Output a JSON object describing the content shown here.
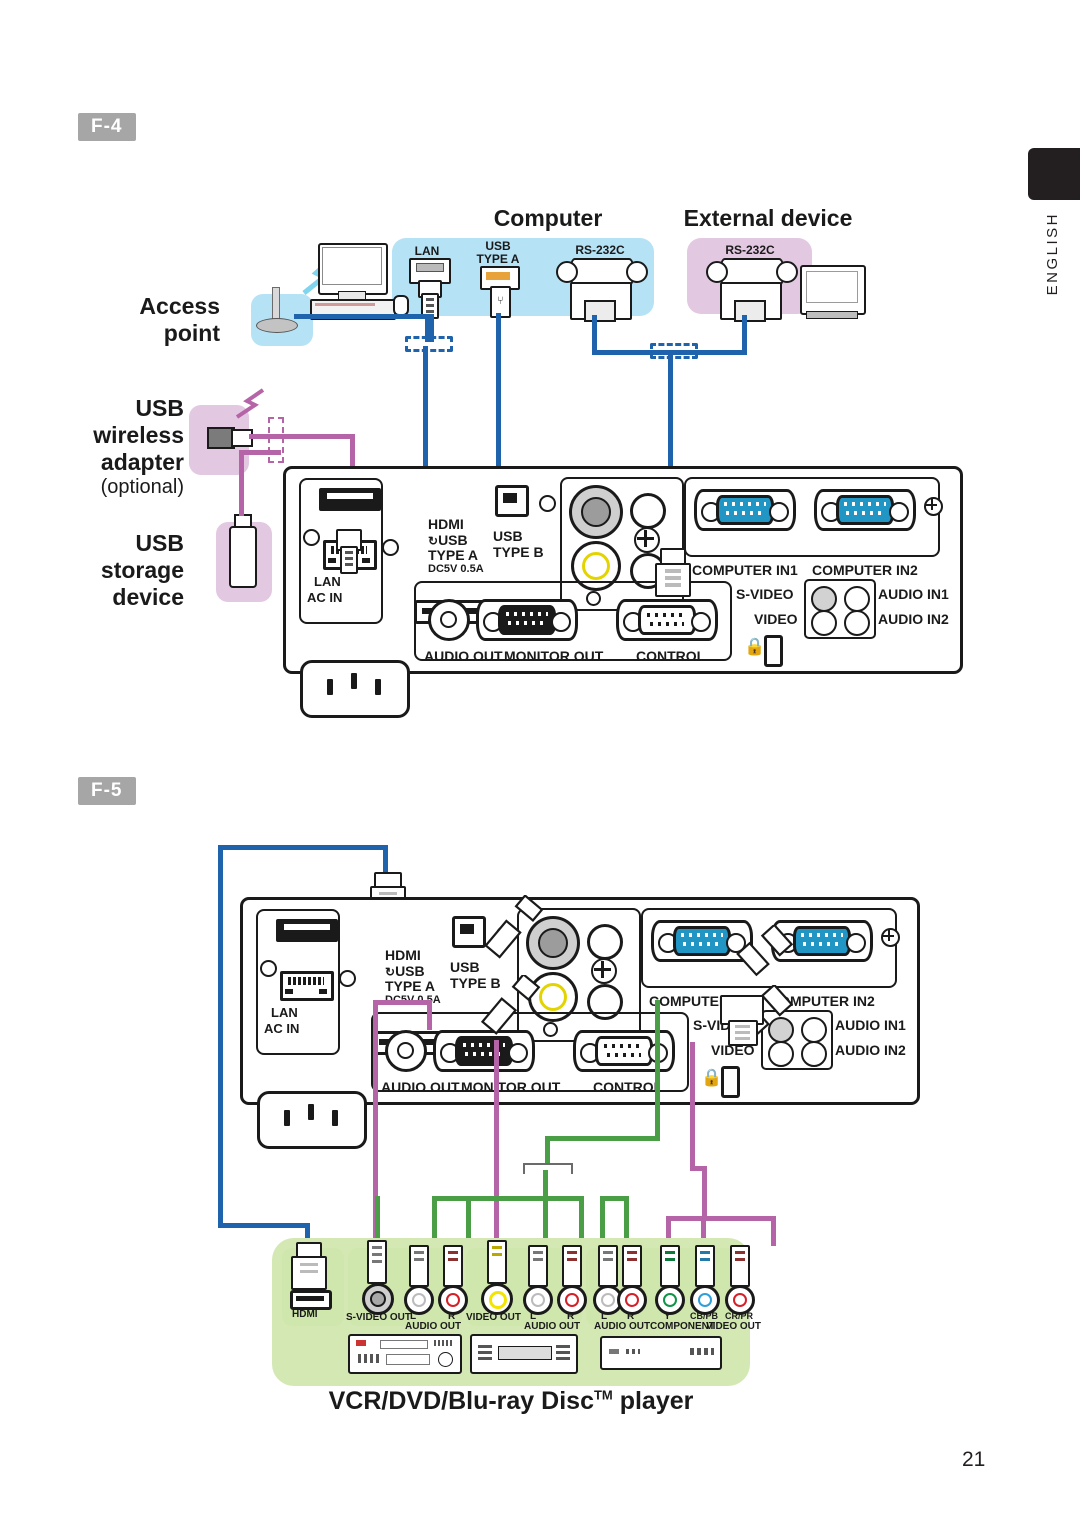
{
  "page": {
    "number": "21",
    "language_tab": "ENGLISH"
  },
  "sections": [
    {
      "id": "f4",
      "badge": "F-4"
    },
    {
      "id": "f5",
      "badge": "F-5"
    }
  ],
  "f4": {
    "captions": {
      "access_point": "Access\npoint",
      "access_point_line1": "Access",
      "access_point_line2": "point",
      "usb_wireless_line1": "USB",
      "usb_wireless_line2": "wireless",
      "usb_wireless_line3": "adapter",
      "usb_wireless_optional": "(optional)",
      "usb_storage_line1": "USB",
      "usb_storage_line2": "storage",
      "usb_storage_line3": "device",
      "computer": "Computer",
      "external_device": "External device"
    },
    "computer_ports": [
      {
        "name": "lan-port",
        "label": "LAN"
      },
      {
        "name": "usb-type-a-port",
        "label_line1": "USB",
        "label_line2": "TYPE A"
      },
      {
        "name": "rs232c-port",
        "label": "RS-232C"
      }
    ],
    "external_ports": [
      {
        "name": "rs232c-port",
        "label": "RS-232C"
      }
    ]
  },
  "projector_panel": {
    "labels": {
      "lan": "LAN",
      "ac_in": "AC IN",
      "hdmi": "HDMI",
      "usb_type_a_1": "USB",
      "usb_type_a_2": "TYPE A",
      "usb_type_a_3": "DC5V 0.5A",
      "usb_type_b_1": "USB",
      "usb_type_b_2": "TYPE B",
      "audio_out": "AUDIO OUT",
      "monitor_out": "MONITOR OUT",
      "control": "CONTROL",
      "computer_in1": "COMPUTER IN1",
      "computer_in2": "COMPUTER IN2",
      "s_video": "S-VIDEO",
      "video": "VIDEO",
      "audio_in1": "AUDIO IN1",
      "audio_in2": "AUDIO IN2"
    }
  },
  "f5": {
    "title": "VCR/DVD/Blu-ray Disc",
    "title_tm": "TM",
    "title_tail": " player",
    "device_groups": [
      {
        "name": "hdmi-device",
        "ports": [
          {
            "label": "HDMI",
            "color": "#1a1a1a"
          }
        ]
      },
      {
        "name": "svideo-device",
        "ports": [
          {
            "label_line1": "S-VIDEO OUT",
            "color": "#9a9a9a"
          },
          {
            "label_line1": "L",
            "label_line2": "AUDIO OUT",
            "color": "#ffffff"
          },
          {
            "label_line1": "R",
            "label_line2": "AUDIO OUT",
            "color": "#d52027"
          }
        ]
      },
      {
        "name": "composite-device",
        "ports": [
          {
            "label_line1": "VIDEO OUT",
            "color": "#f5e400"
          },
          {
            "label_line1": "L",
            "label_line2": "AUDIO OUT",
            "color": "#ffffff"
          },
          {
            "label_line1": "R",
            "label_line2": "AUDIO OUT",
            "color": "#d52027"
          }
        ]
      },
      {
        "name": "component-device",
        "ports": [
          {
            "label_line1": "L",
            "label_line2": "AUDIO OUT",
            "color": "#ffffff"
          },
          {
            "label_line1": "R",
            "label_line2": "AUDIO OUT",
            "color": "#d52027"
          },
          {
            "label_line1": "Y",
            "label_line2": "COMPONENT",
            "color": "#0f9448"
          },
          {
            "label_line1": "CB/PB",
            "label_line2": "VIDEO OUT",
            "color": "#2f9fd9"
          },
          {
            "label_line1": "CR/PR",
            "label_line2": "",
            "color": "#d52027"
          }
        ]
      }
    ],
    "port_labels_row": [
      "HDMI",
      "S-VIDEO OUT",
      "L",
      "R",
      "VIDEO OUT",
      "L",
      "R",
      "L",
      "R",
      "Y",
      "CB/PB",
      "CR/PR"
    ],
    "sub_labels_row": [
      "AUDIO OUT",
      "AUDIO OUT",
      "AUDIO OUT",
      "COMPONENT",
      "VIDEO OUT"
    ]
  },
  "colors": {
    "cable_blue": "#1f63ad",
    "cable_pink": "#b565a7",
    "cable_green": "#4a9e46",
    "group_blue": "#b6e2f5",
    "group_pink": "#e3c8e1",
    "group_green": "#d4e8b4",
    "badge_gray": "#a6a6a6",
    "vga_blue": "#2196c4",
    "ink": "#1a1a1a"
  }
}
